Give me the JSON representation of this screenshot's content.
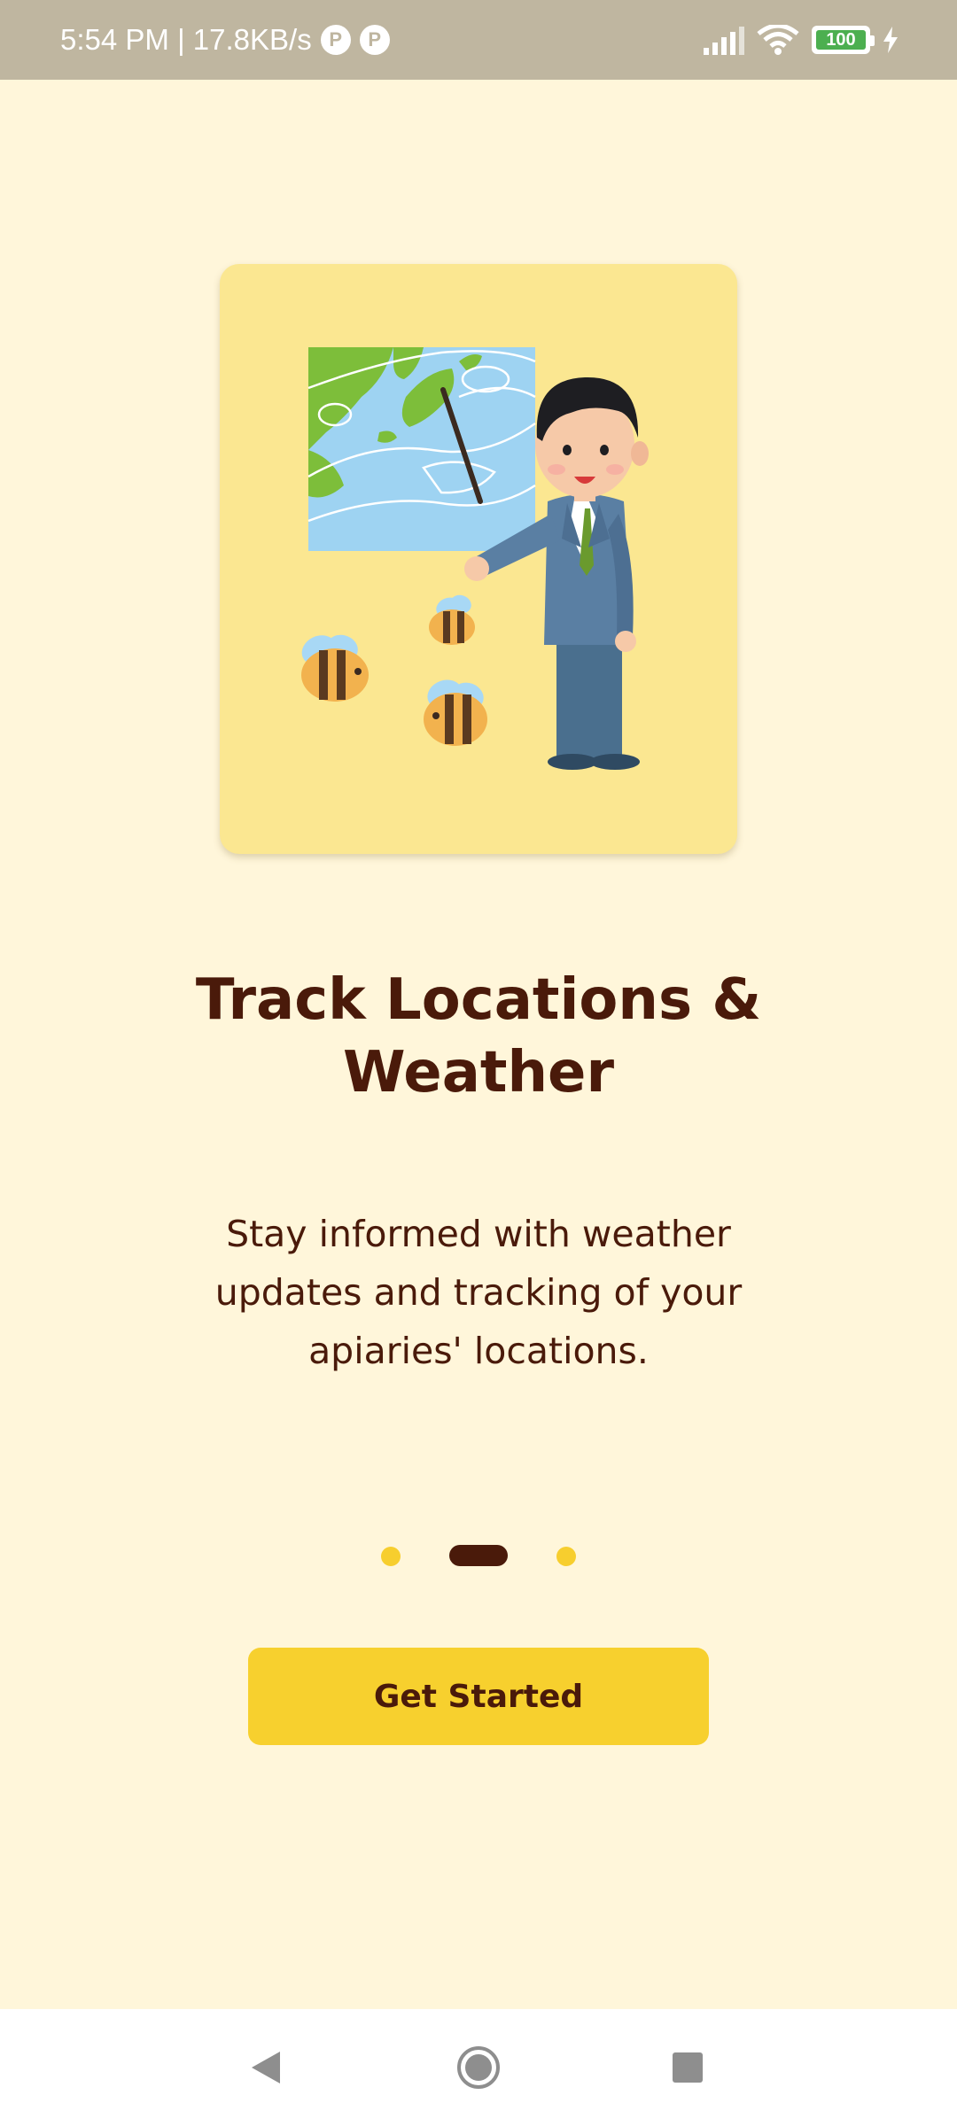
{
  "status_bar": {
    "time_and_speed": "5:54 PM | 17.8KB/s",
    "app_icons": [
      "P",
      "P"
    ],
    "battery_level": "100",
    "battery_color": "#4CAF50"
  },
  "onboarding": {
    "title": "Track Locations & Weather",
    "description": "Stay informed with weather updates and tracking of your apiaries' locations.",
    "current_page_index": 1,
    "page_count": 3,
    "cta_label": "Get Started"
  },
  "theme": {
    "background": "#FFF6DA",
    "card": "#FBE791",
    "accent": "#F7D02E",
    "text": "#4A1A0A"
  },
  "navigation": {
    "icons": [
      "back-icon",
      "home-icon",
      "recents-icon"
    ]
  }
}
